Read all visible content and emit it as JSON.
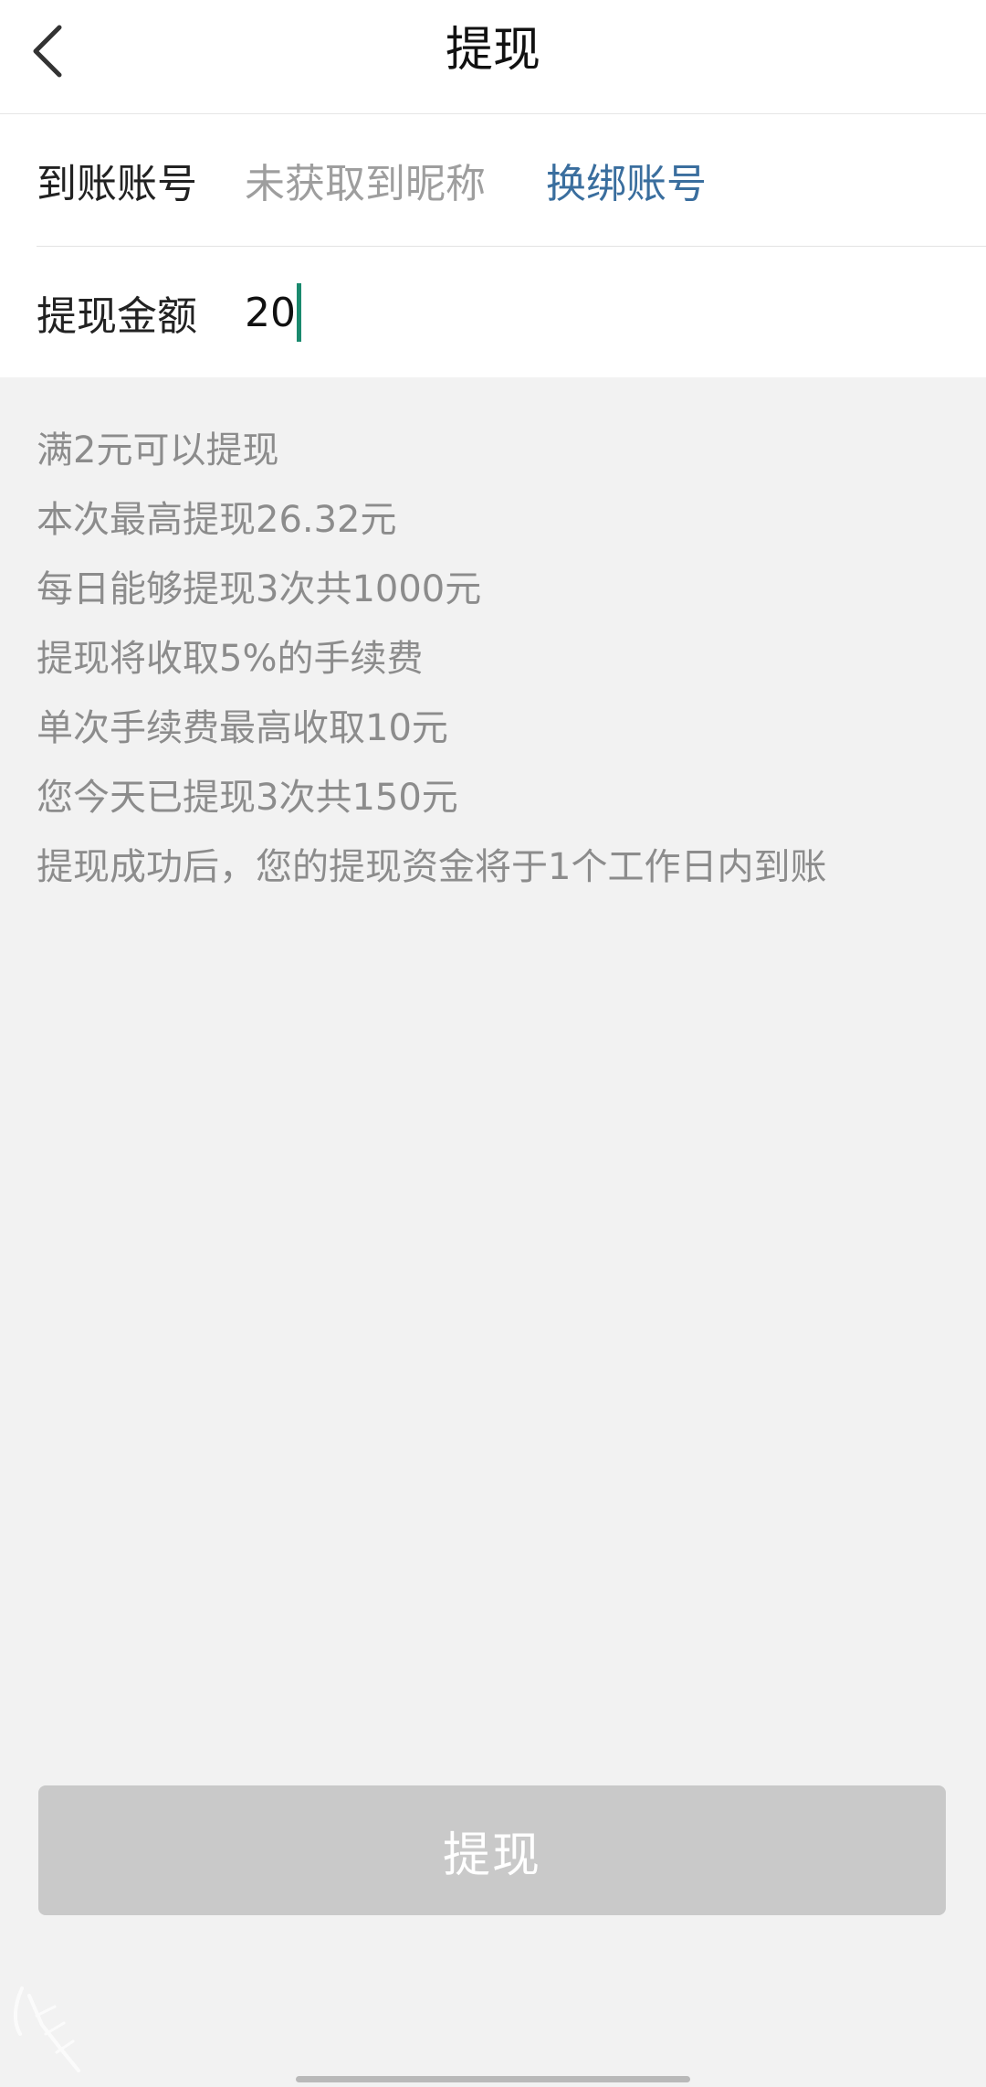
{
  "header": {
    "title": "提现",
    "back_icon": "chevron-left-icon"
  },
  "account": {
    "label": "到账账号",
    "name": "未获取到昵称",
    "rebind_label": "换绑账号",
    "link_color": "#3a6e9e"
  },
  "amount": {
    "label": "提现金额",
    "value": "20"
  },
  "info_lines": [
    "满2元可以提现",
    "本次最高提现26.32元",
    "每日能够提现3次共1000元",
    "提现将收取5%的手续费",
    "单次手续费最高收取10元",
    "您今天已提现3次共150元",
    "提现成功后，您的提现资金将于1个工作日内到账"
  ],
  "submit": {
    "label": "提现",
    "background": "#c9c9c9"
  }
}
